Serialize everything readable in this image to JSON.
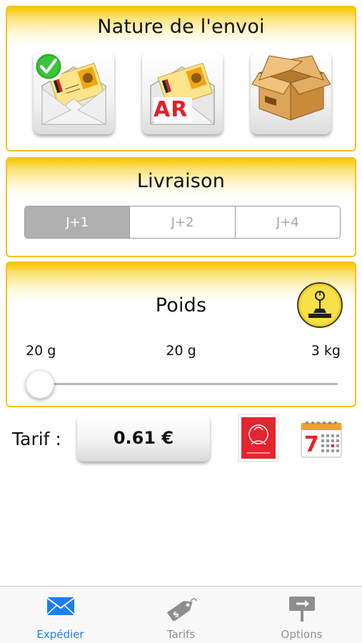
{
  "nature": {
    "title": "Nature de l'envoi",
    "options": [
      {
        "name": "lettre",
        "icon": "envelope-icon",
        "selected": true
      },
      {
        "name": "lettre-ar",
        "icon": "envelope-ar-icon",
        "badge": "AR",
        "selected": false
      },
      {
        "name": "colis",
        "icon": "package-box-icon",
        "selected": false
      }
    ]
  },
  "livraison": {
    "title": "Livraison",
    "segments": [
      "J+1",
      "J+2",
      "J+4"
    ],
    "selected": "J+1"
  },
  "poids": {
    "title": "Poids",
    "min_label": "20 g",
    "current_label": "20 g",
    "max_label": "3 kg",
    "slider_fraction": 0
  },
  "tarif": {
    "label": "Tarif :",
    "price": "0.61 €"
  },
  "tabbar": {
    "tabs": [
      {
        "label": "Expédier",
        "icon": "envelope-icon",
        "active": true
      },
      {
        "label": "Tarifs",
        "icon": "price-tag-icon",
        "active": false
      },
      {
        "label": "Options",
        "icon": "signpost-icon",
        "active": false
      }
    ]
  },
  "colors": {
    "accent_yellow": "#f7c700",
    "tab_active": "#1b7ff0",
    "segment_active": "#b0b0b0",
    "stamp_red": "#e3262e"
  }
}
